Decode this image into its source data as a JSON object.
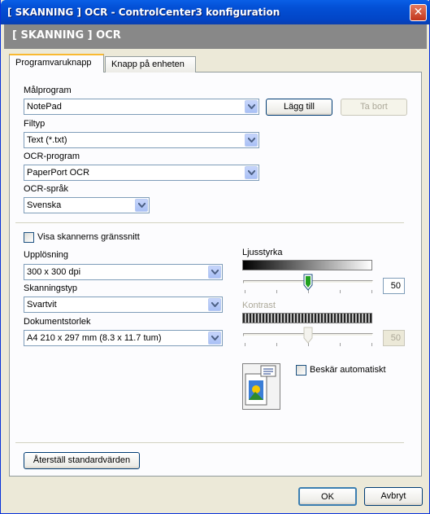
{
  "window": {
    "title": "[ SKANNING ]  OCR - ControlCenter3 konfiguration",
    "close_glyph": "✕"
  },
  "header": {
    "text": "[ SKANNING ]  OCR"
  },
  "tabs": [
    {
      "label": "Programvaruknapp"
    },
    {
      "label": "Knapp på enheten"
    }
  ],
  "target": {
    "label": "Målprogram",
    "value": "NotePad",
    "add_button": "Lägg till",
    "remove_button": "Ta bort"
  },
  "filetype": {
    "label": "Filtyp",
    "value": "Text (*.txt)"
  },
  "ocr": {
    "label": "OCR-program",
    "value": "PaperPort OCR"
  },
  "ocr_lang": {
    "label": "OCR-språk",
    "value": "Svenska"
  },
  "show_ui": {
    "label": "Visa skannerns gränssnitt",
    "checked": false
  },
  "resolution": {
    "label": "Upplösning",
    "value": "300 x 300 dpi"
  },
  "scan_type": {
    "label": "Skanningstyp",
    "value": "Svartvit"
  },
  "doc_size": {
    "label": "Dokumentstorlek",
    "value": "A4 210 x 297 mm (8.3 x 11.7 tum)"
  },
  "brightness": {
    "label": "Ljusstyrka",
    "value": "50"
  },
  "contrast": {
    "label": "Kontrast",
    "value": "50"
  },
  "auto_crop": {
    "label": "Beskär automatiskt",
    "checked": false
  },
  "restore_button": "Återställ standardvärden",
  "ok_button": "OK",
  "cancel_button": "Avbryt",
  "colors": {
    "title_bar": "#0350d6",
    "header_band": "#888888",
    "tab_highlight": "#f9b931"
  }
}
